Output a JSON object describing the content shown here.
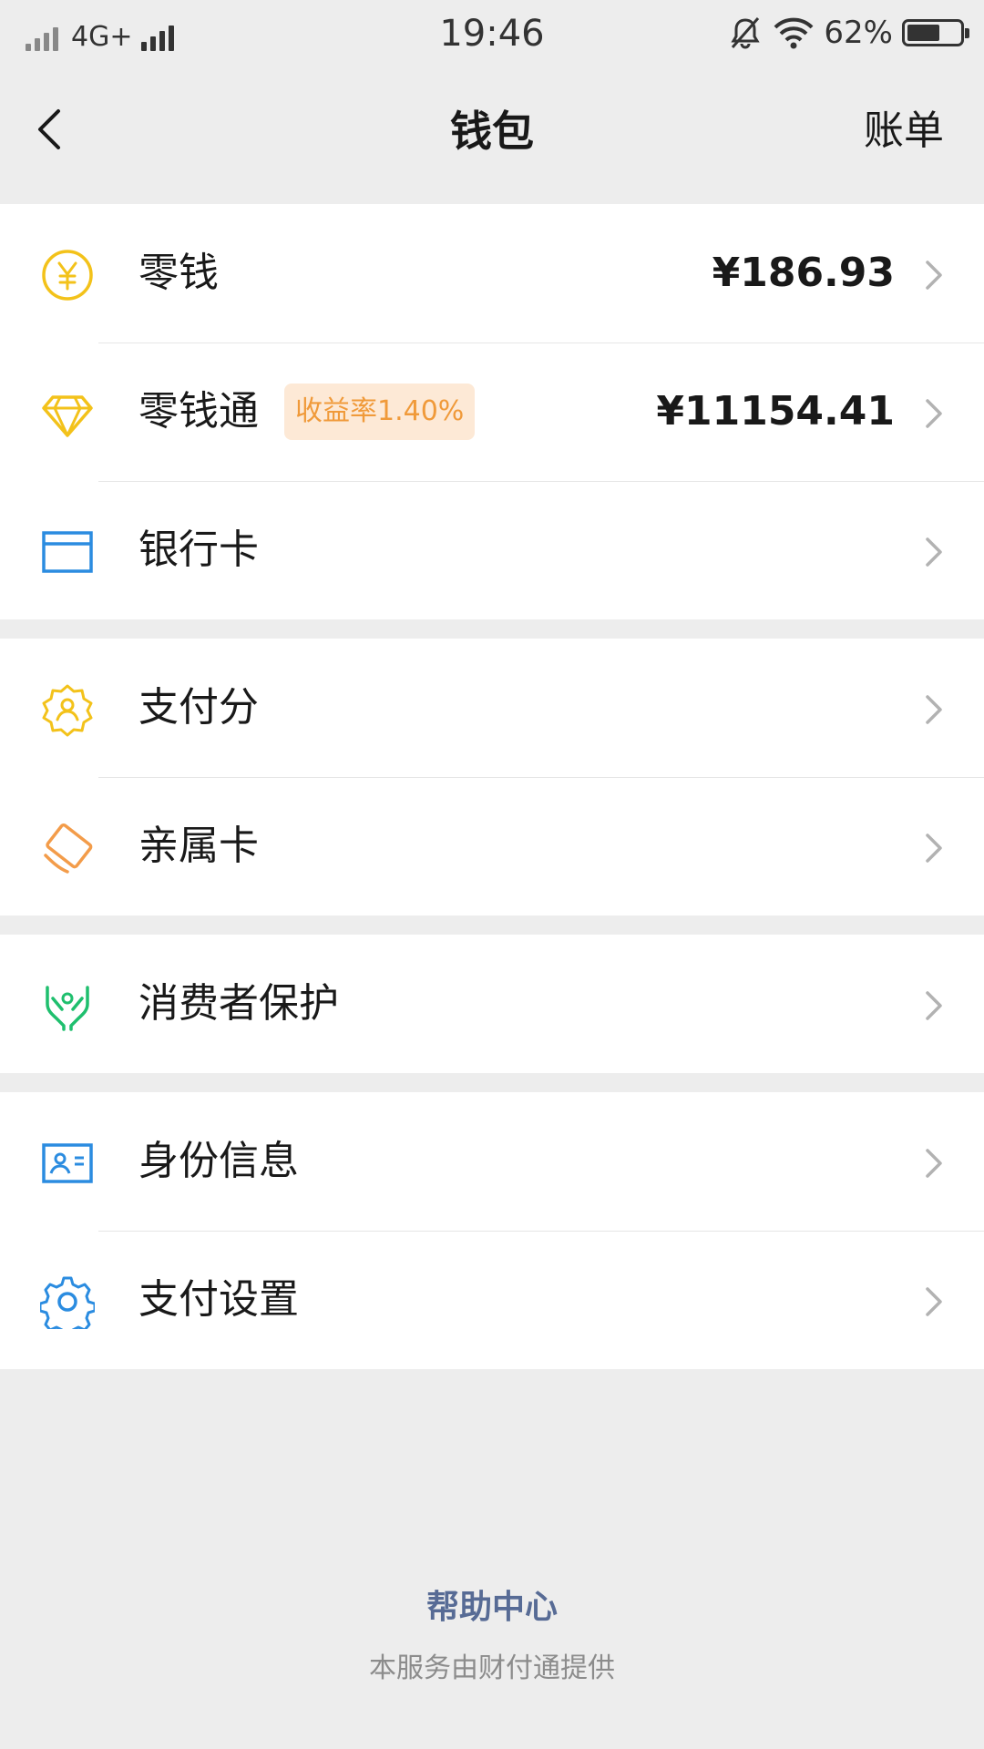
{
  "status_bar": {
    "network": "4G+",
    "time": "19:46",
    "battery_percent": "62%",
    "battery_level": 0.62,
    "icons": [
      "signal-icon",
      "mute-bell-icon",
      "wifi-icon",
      "battery-icon"
    ]
  },
  "nav": {
    "title": "钱包",
    "right_label": "账单",
    "back_icon": "chevron-left-icon"
  },
  "groups": [
    {
      "rows": [
        {
          "label": "零钱",
          "value": "¥186.93",
          "icon": "yuan-coin-icon",
          "color": "#f3c21a"
        },
        {
          "label": "零钱通",
          "badge": "收益率1.40%",
          "value": "¥11154.41",
          "icon": "diamond-icon",
          "color": "#f3c21a"
        },
        {
          "label": "银行卡",
          "icon": "bank-card-icon",
          "color": "#2b8ce0"
        }
      ]
    },
    {
      "rows": [
        {
          "label": "支付分",
          "icon": "credit-score-badge-icon",
          "color": "#f3c21a"
        },
        {
          "label": "亲属卡",
          "icon": "family-card-icon",
          "color": "#f39c4a"
        }
      ]
    },
    {
      "rows": [
        {
          "label": "消费者保护",
          "icon": "protect-hands-icon",
          "color": "#1fbf6e"
        }
      ]
    },
    {
      "rows": [
        {
          "label": "身份信息",
          "icon": "id-card-icon",
          "color": "#2b8ce0"
        },
        {
          "label": "支付设置",
          "icon": "gear-icon",
          "color": "#2b8ce0"
        }
      ]
    }
  ],
  "footer": {
    "help_link": "帮助中心",
    "provider_note": "本服务由财付通提供"
  },
  "colors": {
    "background": "#ededed",
    "link": "#576b95",
    "badge_bg": "#fde9d6",
    "badge_text": "#f09a3a"
  }
}
